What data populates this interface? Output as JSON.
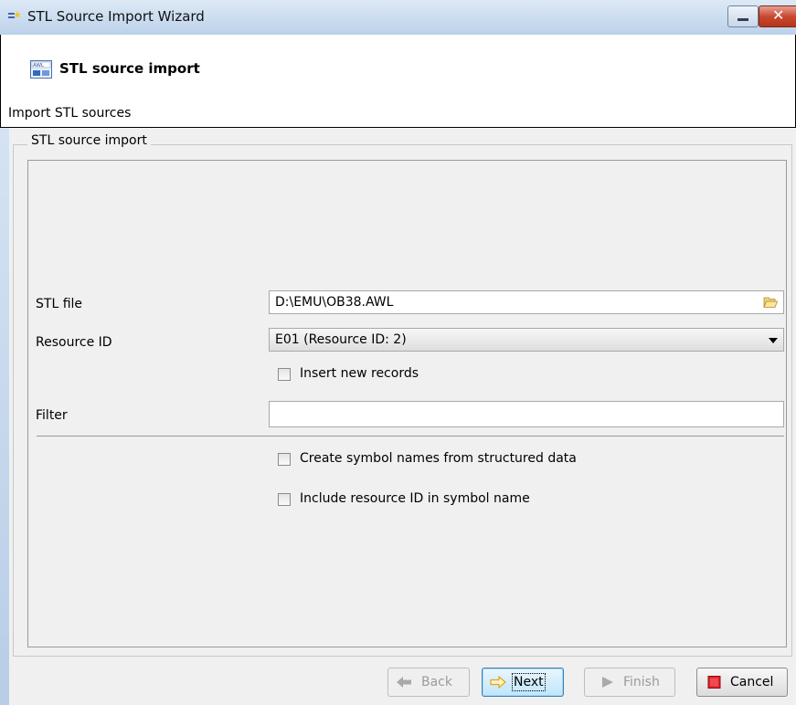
{
  "window": {
    "title": "STL Source Import Wizard"
  },
  "header": {
    "title": "STL source import",
    "subtitle": "Import STL sources"
  },
  "group": {
    "legend": "STL source import"
  },
  "form": {
    "stl_file_label": "STL file",
    "stl_file_value": "D:\\EMU\\OB38.AWL",
    "resource_id_label": "Resource ID",
    "resource_id_value": "E01 (Resource ID: 2)",
    "insert_new_records_label": "Insert new records",
    "insert_new_records_checked": false,
    "filter_label": "Filter",
    "filter_value": "",
    "create_symbol_names_label": "Create symbol names from structured data",
    "create_symbol_names_checked": false,
    "include_resource_id_label": "Include resource ID in symbol name",
    "include_resource_id_checked": false
  },
  "buttons": {
    "back": "Back",
    "next": "Next",
    "finish": "Finish",
    "cancel": "Cancel"
  },
  "colors": {
    "accent": "#3c7fb1",
    "cancel_icon": "#e0202a",
    "arrow_icon": "#e3b32a"
  }
}
